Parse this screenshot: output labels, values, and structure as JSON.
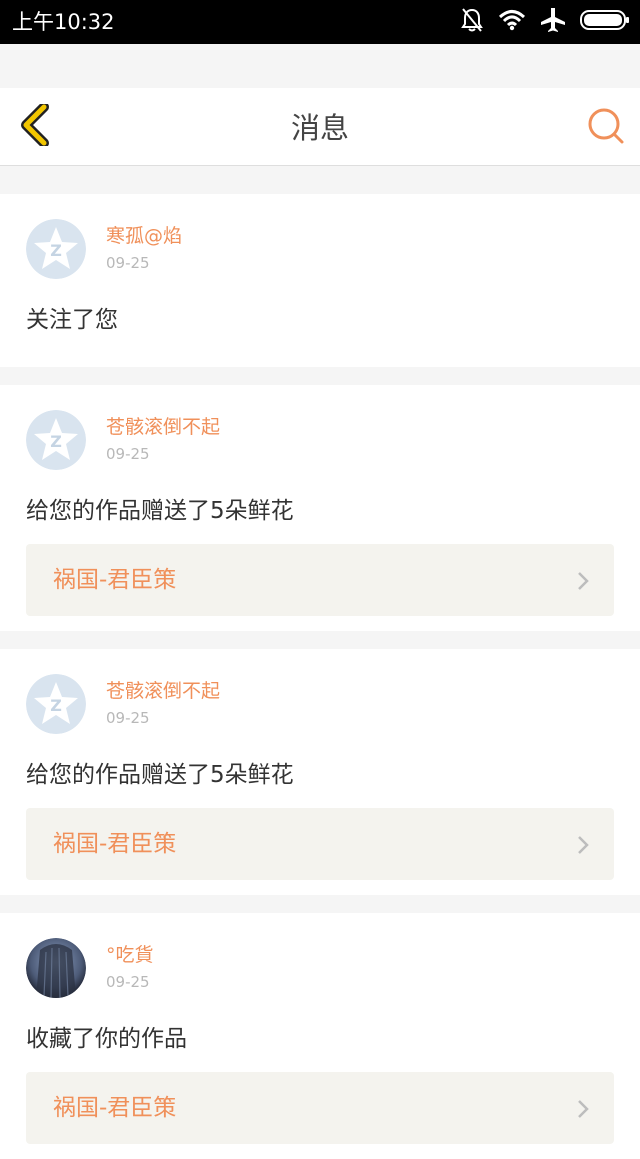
{
  "status_bar": {
    "time": "上午10:32"
  },
  "header": {
    "title": "消息"
  },
  "colors": {
    "accent_orange": "#f0905a",
    "back_arrow": "#f2c600"
  },
  "messages": [
    {
      "user": "寒孤@焰",
      "date": "09-25",
      "action": "关注了您",
      "avatar": "default-qq-avatar-icon"
    },
    {
      "user": "苍骸滚倒不起",
      "date": "09-25",
      "action": "给您的作品赠送了5朵鲜花",
      "avatar": "default-qq-avatar-icon",
      "work": "祸国-君臣策"
    },
    {
      "user": "苍骸滚倒不起",
      "date": "09-25",
      "action": "给您的作品赠送了5朵鲜花",
      "avatar": "default-qq-avatar-icon",
      "work": "祸国-君臣策"
    },
    {
      "user": "°吃貨",
      "date": "09-25",
      "action": "收藏了你的作品",
      "avatar": "photo-avatar",
      "work": "祸国-君臣策"
    }
  ]
}
